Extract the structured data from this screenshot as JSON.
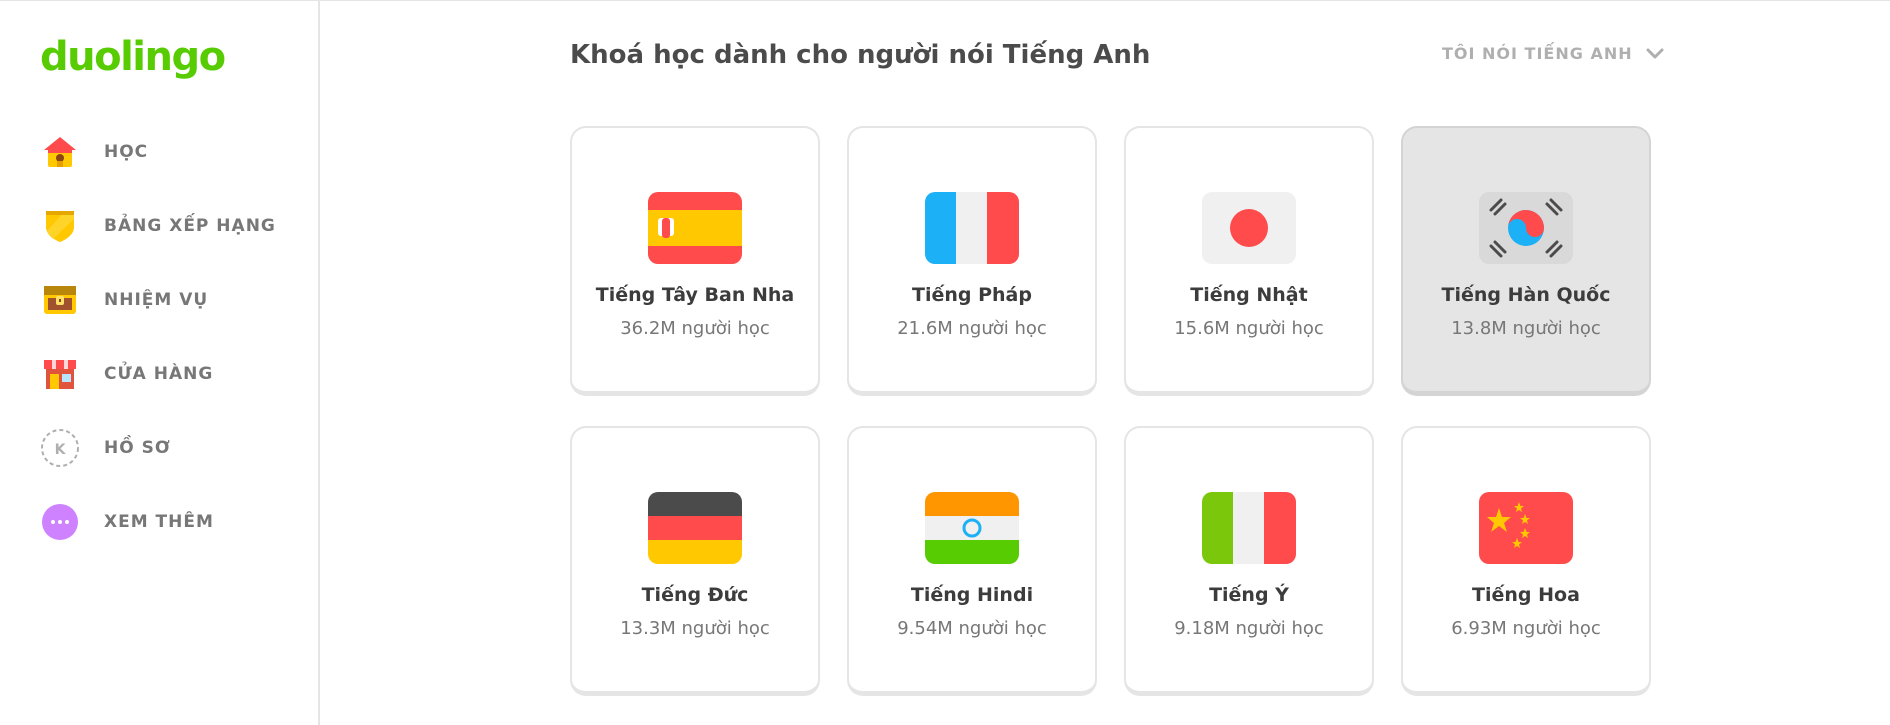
{
  "app": {
    "logo": "duolingo"
  },
  "sidebar": {
    "items": [
      {
        "label": "HỌC",
        "icon": "home-icon"
      },
      {
        "label": "BẢNG XẾP HẠNG",
        "icon": "shield-icon"
      },
      {
        "label": "NHIỆM VỤ",
        "icon": "treasure-chest-icon"
      },
      {
        "label": "CỬA HÀNG",
        "icon": "shop-icon"
      },
      {
        "label": "HỒ SƠ",
        "icon": "profile-avatar-icon",
        "avatar_letter": "K"
      },
      {
        "label": "XEM THÊM",
        "icon": "more-icon"
      }
    ]
  },
  "header": {
    "title": "Khoá học dành cho người nói Tiếng Anh",
    "language_selector": "TÔI NÓI TIẾNG ANH"
  },
  "courses": [
    {
      "name": "Tiếng Tây Ban Nha",
      "learners": "36.2M người học",
      "flag": "spain-flag-icon"
    },
    {
      "name": "Tiếng Pháp",
      "learners": "21.6M người học",
      "flag": "france-flag-icon"
    },
    {
      "name": "Tiếng Nhật",
      "learners": "15.6M người học",
      "flag": "japan-flag-icon"
    },
    {
      "name": "Tiếng Hàn Quốc",
      "learners": "13.8M người học",
      "flag": "korea-flag-icon",
      "highlighted": true
    },
    {
      "name": "Tiếng Đức",
      "learners": "13.3M người học",
      "flag": "germany-flag-icon"
    },
    {
      "name": "Tiếng Hindi",
      "learners": "9.54M người học",
      "flag": "india-flag-icon"
    },
    {
      "name": "Tiếng Ý",
      "learners": "9.18M người học",
      "flag": "italy-flag-icon"
    },
    {
      "name": "Tiếng Hoa",
      "learners": "6.93M người học",
      "flag": "china-flag-icon"
    }
  ],
  "colors": {
    "brand": "#58cc02",
    "text": "#4b4b4b",
    "muted": "#777777",
    "border": "#e5e5e5"
  }
}
